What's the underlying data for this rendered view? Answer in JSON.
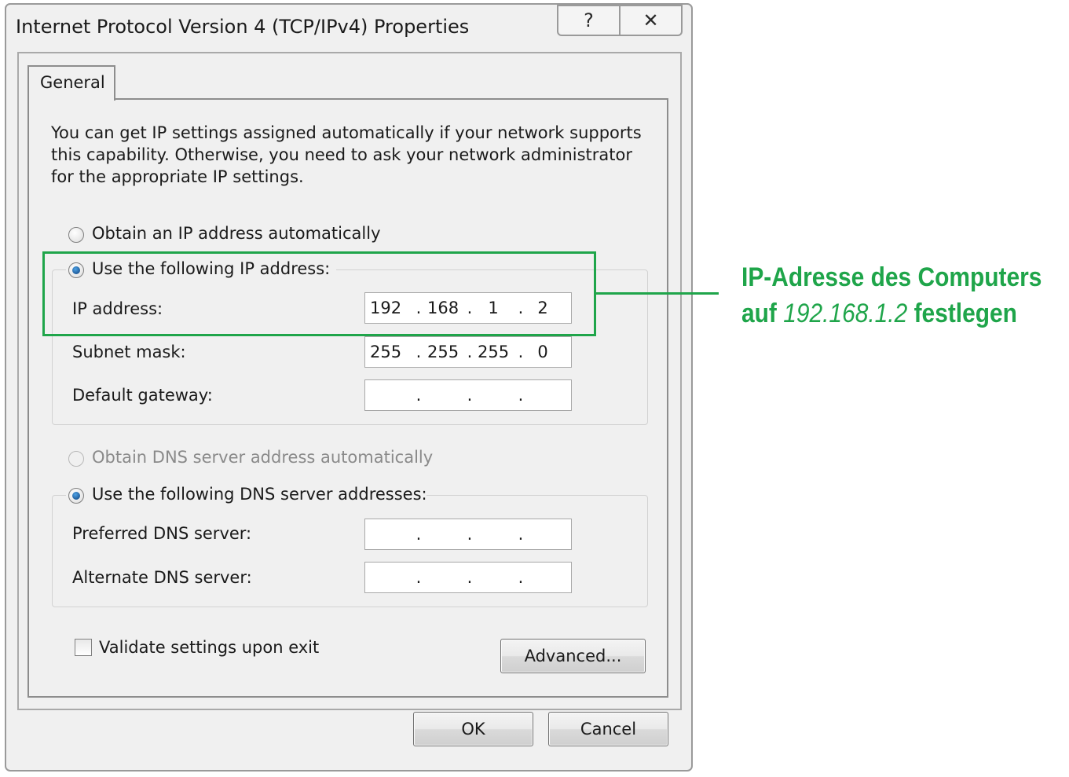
{
  "window": {
    "title": "Internet Protocol Version 4 (TCP/IPv4) Properties",
    "help_glyph": "?",
    "close_glyph": "✕",
    "help_icon": "question-icon",
    "close_icon": "close-icon"
  },
  "tabs": [
    {
      "label": "General",
      "selected": true
    }
  ],
  "intro": "You can get IP settings assigned automatically if your network supports\nthis capability. Otherwise, you need to ask your network administrator\nfor the appropriate IP settings.",
  "ip_mode": {
    "auto_label": "Obtain an IP address automatically",
    "manual_label": "Use the following IP address:",
    "selected": "manual"
  },
  "ip_fields": {
    "ip_address": {
      "label": "IP address:",
      "octets": [
        "192",
        "168",
        "1",
        "2"
      ]
    },
    "subnet_mask": {
      "label": "Subnet mask:",
      "octets": [
        "255",
        "255",
        "255",
        "0"
      ]
    },
    "default_gateway": {
      "label": "Default gateway:",
      "octets": [
        "",
        "",
        "",
        ""
      ]
    }
  },
  "dns_mode": {
    "auto_label": "Obtain DNS server address automatically",
    "auto_disabled": true,
    "manual_label": "Use the following DNS server addresses:",
    "selected": "manual"
  },
  "dns_fields": {
    "preferred": {
      "label": "Preferred DNS server:",
      "octets": [
        "",
        "",
        "",
        ""
      ]
    },
    "alternate": {
      "label": "Alternate DNS server:",
      "octets": [
        "",
        "",
        "",
        ""
      ]
    }
  },
  "validate": {
    "label": "Validate settings upon exit",
    "checked": false
  },
  "buttons": {
    "advanced": "Advanced...",
    "ok": "OK",
    "cancel": "Cancel"
  },
  "annotation": {
    "line1": "IP-Adresse des Computers",
    "line2_prefix": "auf",
    "line2_value": "192.168.1.2",
    "line2_suffix": "festlegen",
    "color": "#1fa54a"
  },
  "colors": {
    "window_bg": "#f0f0f0",
    "radio_selected": "#0b3e7a"
  }
}
